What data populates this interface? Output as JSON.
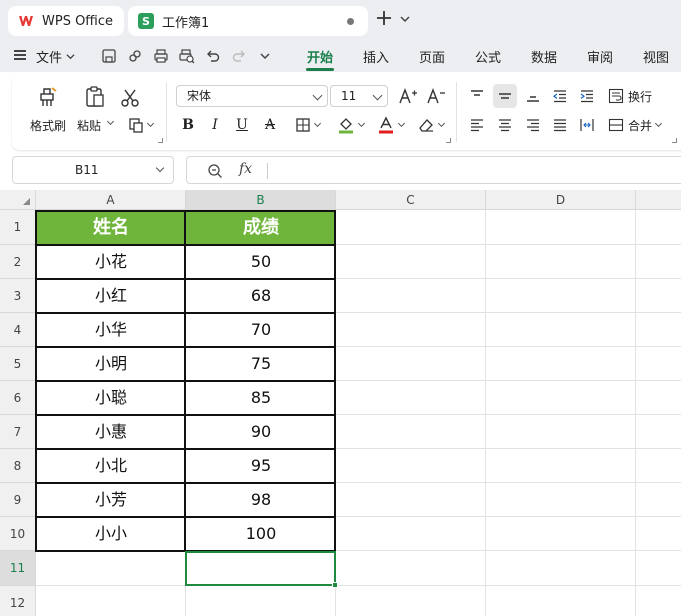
{
  "app": {
    "home_tab": "WPS Office",
    "doc_tab": "工作簿1"
  },
  "menu": {
    "file": "文件",
    "tabs": [
      "开始",
      "插入",
      "页面",
      "公式",
      "数据",
      "审阅",
      "视图"
    ],
    "active_tab": "开始"
  },
  "ribbon": {
    "format_painter": "格式刷",
    "paste": "粘贴",
    "font_name": "宋体",
    "font_size": "11",
    "wrap_text": "换行",
    "merge": "合并"
  },
  "formula_bar": {
    "name_box": "B11",
    "fx": "fx",
    "content": ""
  },
  "grid": {
    "columns": [
      "A",
      "B",
      "C",
      "D"
    ],
    "selected_column": "B",
    "rows": [
      "1",
      "2",
      "3",
      "4",
      "5",
      "6",
      "7",
      "8",
      "9",
      "10",
      "11",
      "12"
    ],
    "selected_row": "11",
    "header": [
      "姓名",
      "成绩"
    ],
    "data": [
      [
        "小花",
        "50"
      ],
      [
        "小红",
        "68"
      ],
      [
        "小华",
        "70"
      ],
      [
        "小明",
        "75"
      ],
      [
        "小聪",
        "85"
      ],
      [
        "小惠",
        "90"
      ],
      [
        "小北",
        "95"
      ],
      [
        "小芳",
        "98"
      ],
      [
        "小小",
        "100"
      ]
    ]
  },
  "colors": {
    "accent": "#1a7f4b",
    "table_header_fill": "#6fb53c",
    "active_cell_border": "#1f8a3f"
  }
}
